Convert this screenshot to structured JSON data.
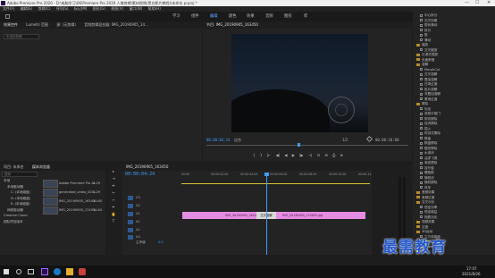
{
  "window": {
    "title": "Adobe Premiere Pro 2020 - D:\\电脑学习\\06\\Premiere Pro 2020 人像剪辑\\素材视频(黑白影片教程)\\未命名.prproj *",
    "min": "—",
    "max": "☐",
    "close": "✕"
  },
  "menu": [
    "文件(F)",
    "编辑(E)",
    "剪辑(C)",
    "序列(S)",
    "标记(M)",
    "图形(G)",
    "视图(V)",
    "窗口(W)",
    "帮助(H)"
  ],
  "workspaces": [
    "学习",
    "组件",
    "编辑",
    "颜色",
    "效果",
    "音频",
    "图形",
    "库"
  ],
  "workspace_active": "编辑",
  "source_panel": {
    "tabs": [
      "效果控件",
      "Lumetri 范围",
      "源: (无剪辑)",
      "音频剪辑混合器: IMG_20190905_14..."
    ],
    "search_placeholder": "未选择剪辑"
  },
  "program": {
    "tab": "节目: IMG_20190905_163450",
    "timecode": "00:00:04:24",
    "fit": "适合",
    "quality": "1/2",
    "duration": "00:00:10:00",
    "transport": [
      "{",
      "}",
      "|←",
      "◀|",
      "◀",
      "▶",
      "|▶",
      "→|",
      "⊟",
      "⊞",
      "⎙",
      "⊕"
    ]
  },
  "effects": {
    "items": [
      {
        "label": "中心拆分",
        "type": "fx"
      },
      {
        "label": "交叉划像",
        "type": "fx"
      },
      {
        "label": "带状滑动",
        "type": "fx"
      },
      {
        "label": "拆分",
        "type": "fx"
      },
      {
        "label": "推",
        "type": "fx"
      },
      {
        "label": "滑动",
        "type": "fx"
      },
      {
        "label": "缩放",
        "type": "folder"
      },
      {
        "label": "交叉缩放",
        "type": "fx"
      },
      {
        "label": "沉浸式视频",
        "type": "folder"
      },
      {
        "label": "页面剥落",
        "type": "folder"
      },
      {
        "label": "溶解",
        "type": "folder"
      },
      {
        "label": "MorphCut",
        "type": "fx"
      },
      {
        "label": "交叉溶解",
        "type": "fx"
      },
      {
        "label": "叠加溶解",
        "type": "fx"
      },
      {
        "label": "白场过渡",
        "type": "fx"
      },
      {
        "label": "胶片溶解",
        "type": "fx"
      },
      {
        "label": "非叠加溶解",
        "type": "fx"
      },
      {
        "label": "黑场过渡",
        "type": "fx"
      },
      {
        "label": "擦除",
        "type": "folder"
      },
      {
        "label": "划出",
        "type": "fx"
      },
      {
        "label": "双侧平推门",
        "type": "fx"
      },
      {
        "label": "带状擦除",
        "type": "fx"
      },
      {
        "label": "径向擦除",
        "type": "fx"
      },
      {
        "label": "插入",
        "type": "fx"
      },
      {
        "label": "时钟式擦除",
        "type": "fx"
      },
      {
        "label": "棋盘",
        "type": "fx"
      },
      {
        "label": "棋盘擦除",
        "type": "fx"
      },
      {
        "label": "楔形擦除",
        "type": "fx"
      },
      {
        "label": "水波块",
        "type": "fx"
      },
      {
        "label": "油漆飞溅",
        "type": "fx"
      },
      {
        "label": "渐变擦除",
        "type": "fx"
      },
      {
        "label": "百叶窗",
        "type": "fx"
      },
      {
        "label": "螺旋框",
        "type": "fx"
      },
      {
        "label": "随机块",
        "type": "fx"
      },
      {
        "label": "随机擦除",
        "type": "fx"
      },
      {
        "label": "风车",
        "type": "fx"
      },
      {
        "label": "音频效果",
        "type": "folder"
      },
      {
        "label": "音频过渡",
        "type": "folder"
      },
      {
        "label": "交叉淡化",
        "type": "folder"
      },
      {
        "label": "恒定功率",
        "type": "fx"
      },
      {
        "label": "恒定增益",
        "type": "fx"
      },
      {
        "label": "指数淡化",
        "type": "fx"
      },
      {
        "label": "视频效果",
        "type": "folder"
      },
      {
        "label": "过渡",
        "type": "folder"
      },
      {
        "label": "3D运动",
        "type": "folder"
      },
      {
        "label": "立方体旋转",
        "type": "fx"
      },
      {
        "label": "翻转",
        "type": "fx"
      },
      {
        "label": "Lumetri预设",
        "type": "folder"
      },
      {
        "label": "预设",
        "type": "folder"
      }
    ]
  },
  "project": {
    "tabs": [
      "项目: 未命名",
      "媒体浏览器"
    ],
    "search_placeholder": "搜索",
    "tree": [
      "本地",
      "本地驱动器",
      "C: (本地磁盘)",
      "D: (本地磁盘)",
      "E: (本地磁盘)",
      "网络驱动器",
      "Creative Cloud",
      "团队项目版本"
    ],
    "files": [
      "Adobe Premiere Pro A...",
      "generated_video_020...",
      "IMG_20190905_16345...",
      "IMG_20190905_17455..."
    ],
    "file_durations": [
      "4:29",
      "4:29",
      "10:00",
      "10:00"
    ]
  },
  "timeline": {
    "tab": "IMG_20190905_163450",
    "timecode": "00:00:04:24",
    "ruler": [
      "00:00",
      "00:00:02:00",
      "00:00:04:00",
      "00:00:06:00",
      "00:00:08:00",
      "00:00:10:00",
      "00:00:12:00"
    ],
    "tracks": [
      "V3",
      "V2",
      "V1",
      "A1",
      "A2",
      "A3",
      "主声道"
    ],
    "master_value": "0.0",
    "clip1": "IMG_20190905_163450.jpg",
    "transition": "交叉溶解",
    "clip2": "IMG_20190905_174855.jpg"
  },
  "watermark": "最需教育",
  "taskbar": {
    "time": "17:07",
    "date": "2021/8/26"
  }
}
